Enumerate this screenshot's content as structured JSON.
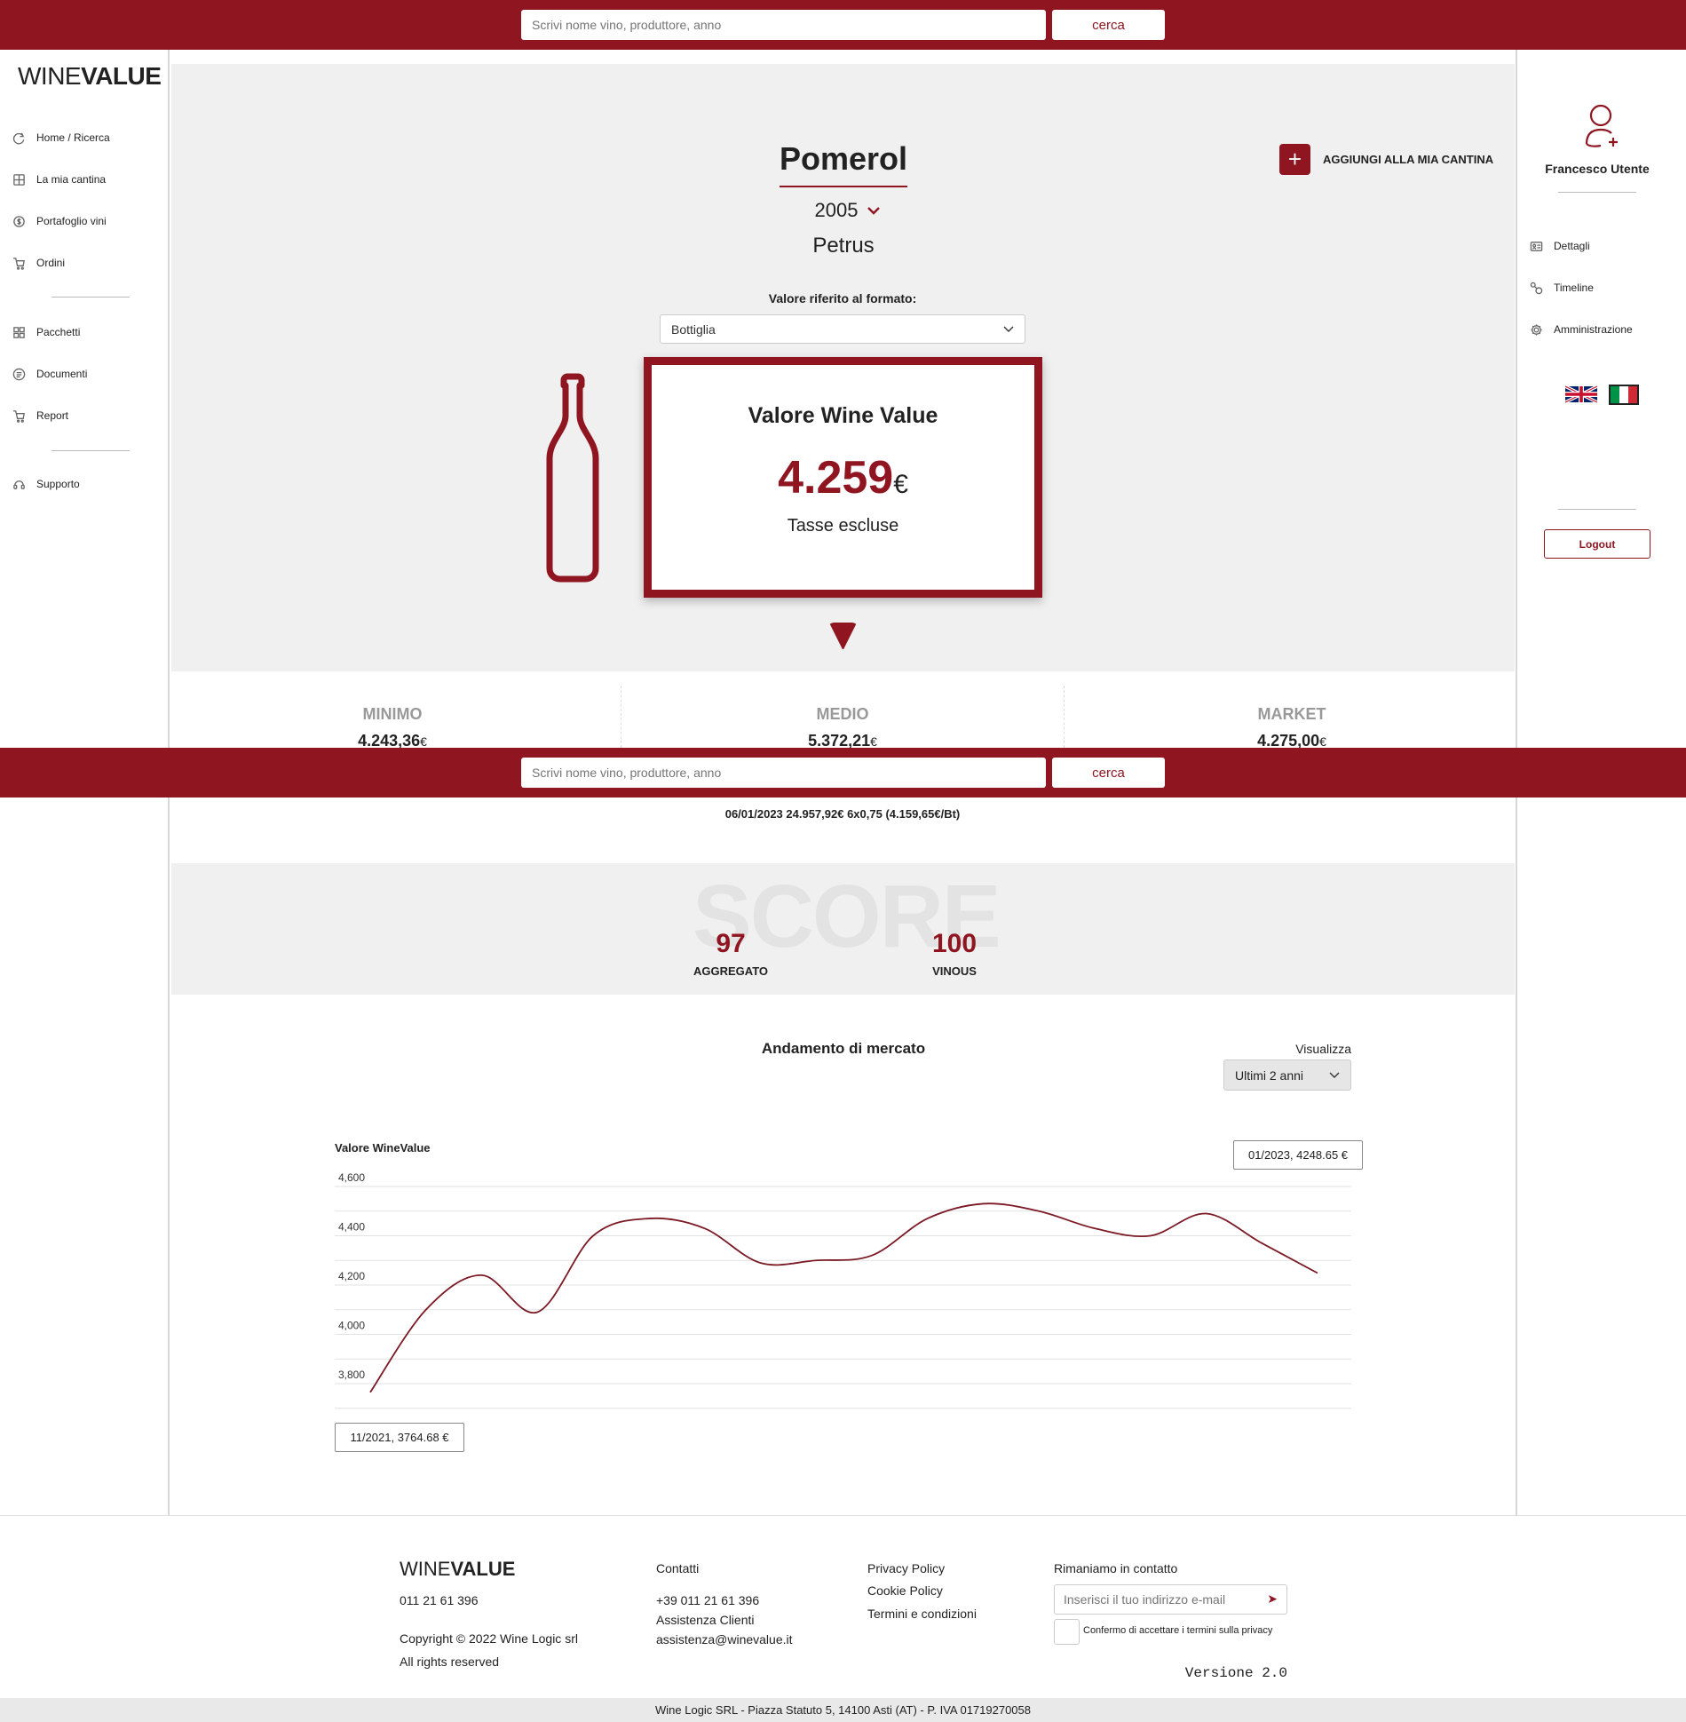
{
  "search": {
    "placeholder": "Scrivi nome vino, produttore, anno",
    "button": "cerca"
  },
  "logo": {
    "light": "WINE",
    "bold": "VALUE"
  },
  "sidebar": {
    "items": [
      {
        "label": "Home / Ricerca",
        "icon": "home-search-icon"
      },
      {
        "label": "La mia cantina",
        "icon": "cellar-icon"
      },
      {
        "label": "Portafoglio vini",
        "icon": "portfolio-icon"
      },
      {
        "label": "Ordini",
        "icon": "cart-icon"
      },
      {
        "label": "Pacchetti",
        "icon": "packages-icon"
      },
      {
        "label": "Documenti",
        "icon": "documents-icon"
      },
      {
        "label": "Report",
        "icon": "report-icon"
      },
      {
        "label": "Supporto",
        "icon": "support-icon"
      }
    ]
  },
  "user": {
    "name": "Francesco Utente",
    "menu": [
      {
        "label": "Dettagli",
        "icon": "details-icon"
      },
      {
        "label": "Timeline",
        "icon": "timeline-icon"
      },
      {
        "label": "Amministrazione",
        "icon": "admin-gear-icon"
      }
    ],
    "logout": "Logout"
  },
  "wine": {
    "name": "Pomerol",
    "vintage": "2005",
    "producer": "Petrus",
    "add_cellar": "AGGIUNGI ALLA MIA CANTINA",
    "format_label": "Valore riferito al formato:",
    "format_selected": "Bottiglia"
  },
  "value_card": {
    "title": "Valore Wine Value",
    "amount": "4.259",
    "currency": "€",
    "note": "Tasse escluse"
  },
  "stats": [
    {
      "label": "MINIMO",
      "value": "4.243,36",
      "currency": "€"
    },
    {
      "label": "MEDIO",
      "value": "5.372,21",
      "currency": "€"
    },
    {
      "label": "MARKET",
      "value": "4.275,00",
      "currency": "€"
    }
  ],
  "market_line": "06/01/2023 24.957,92€ 6x0,75 (4.159,65€/Bt)",
  "score": {
    "watermark": "SCORE",
    "items": [
      {
        "value": "97",
        "label": "AGGREGATO"
      },
      {
        "value": "100",
        "label": "VINOUS"
      }
    ]
  },
  "market": {
    "title": "Andamento di mercato",
    "view_label": "Visualizza",
    "view_selected": "Ultimi 2 anni",
    "tooltip_max": "01/2023, 4248.65 €",
    "tooltip_min": "11/2021, 3764.68 €"
  },
  "chart_data": {
    "type": "line",
    "title": "Valore WineValue",
    "xlabel": "",
    "ylabel": "",
    "ylim": [
      3800,
      4600
    ],
    "yticks": [
      "4,600",
      "4,400",
      "4,200",
      "4,000",
      "3,800"
    ],
    "grid": true,
    "series": [
      {
        "values": [
          3764.68,
          4100,
          4240,
          4090,
          4400,
          4470,
          4430,
          4290,
          4300,
          4320,
          4470,
          4530,
          4500,
          4430,
          4400,
          4490,
          4370,
          4248.65
        ]
      }
    ],
    "color": "#7b1a25"
  },
  "footer": {
    "phone_main": "011 21 61 396",
    "copyright": "Copyright © 2022 Wine Logic srl",
    "rights": "All rights reserved",
    "contacts_title": "Contatti",
    "contacts_phone": "+39 011 21 61 396",
    "contacts_service": "Assistenza Clienti",
    "contacts_email": "assistenza@winevalue.it",
    "links": [
      "Privacy Policy",
      "Cookie Policy",
      "Termini e condizioni"
    ],
    "newsletter_title": "Rimaniamo in contatto",
    "newsletter_placeholder": "Inserisci il tuo indirizzo e-mail",
    "privacy_check": "Confermo di accettare i termini sulla privacy",
    "version": "Versione 2.0",
    "company": "Wine Logic SRL - Piazza Statuto 5, 14100 Asti (AT) - P. IVA 01719270058"
  },
  "colors": {
    "brand": "#8f1520",
    "band": "#f0f0f0"
  }
}
